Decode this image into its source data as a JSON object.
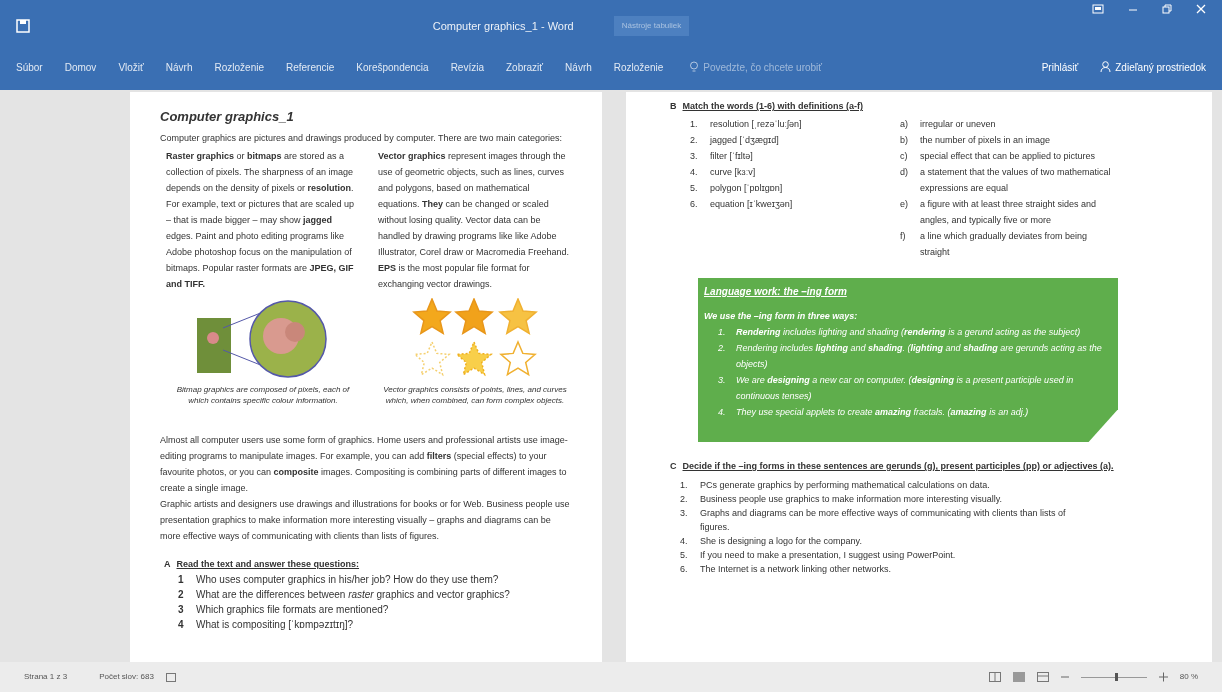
{
  "window": {
    "title": "Computer graphics_1 - Word",
    "context_label": "Nástroje tabuliek"
  },
  "ribbon": {
    "tabs": [
      {
        "label": "Súbor",
        "selected": false
      },
      {
        "label": "Domov",
        "selected": false
      },
      {
        "label": "Vložiť",
        "selected": false
      },
      {
        "label": "Návrh",
        "selected": false
      },
      {
        "label": "Rozloženie",
        "selected": false
      },
      {
        "label": "Referencie",
        "selected": false
      },
      {
        "label": "Korešpondencia",
        "selected": false
      },
      {
        "label": "Revízia",
        "selected": false
      },
      {
        "label": "Zobraziť",
        "selected": false
      },
      {
        "label": "Návrh",
        "selected": false
      },
      {
        "label": "Rozloženie",
        "selected": false
      }
    ],
    "tell_me": "Povedzte, čo chcete urobiť",
    "sign_in": "Prihlásiť",
    "share": "Zdieľaný prostriedok"
  },
  "left_page": {
    "title": "Computer graphics_1",
    "intro": "Computer graphics are pictures and drawings produced by computer. There are two main categories:",
    "columns": [
      "**Raster graphics** or **bitmaps** are stored as a collection of pixels. The sharpness of an image depends on the density of pixels or **resolution**. For example, text or pictures that are scaled up – that is made bigger – may show **jagged** edges. Paint and photo editing programs like Adobe photoshop focus on the manipulation of bitmaps. Popular raster formats are **JPEG, GIF and TIFF.**",
      "**Vector graphics** represent images through the use of geometric objects, such as lines, curves and polygons, based on mathematical equations. **They** can be changed or scaled without losing quality. Vector data can be handled by drawing programs like like Adobe Illustrator, Corel draw or Macromedia Freehand. **EPS** is the most popular file format for exchanging vector drawings."
    ],
    "captions": [
      "Bitmap graphics are composed of pixels, each of which contains specific colour information.",
      "Vector graphics consists of points, lines, and curves which, when combined, can form complex objects."
    ],
    "paragraphs": [
      "Almost all computer users use some form of graphics. Home users and professional artists use image-editing programs to manipulate images. For example, you can add **filters** (special effects) to your favourite photos, or you can **composite** images. Compositing is combining parts of different images to create a single image.",
      "Graphic artists and designers use drawings and illustrations for books or for Web. Business people use presentation graphics to make information more interesting visually – graphs and diagrams can be more effective ways of communicating with clients than lists of figures."
    ],
    "section_a": {
      "letter": "A",
      "heading": "Read the text and answer these questions:",
      "items": [
        {
          "number": "1",
          "text": "Who uses computer graphics in his/her job? How do they use them?"
        },
        {
          "number": "2",
          "text": "What are the differences between *raster* graphics and vector graphics?"
        },
        {
          "number": "3",
          "text": "Which graphics file formats are mentioned?"
        },
        {
          "number": "4",
          "text": "What is compositing [ˈkɒmpəzɪtɪŋ]?"
        }
      ]
    }
  },
  "right_page": {
    "section_b": {
      "letter": "B",
      "heading": "Match the words (1-6) with definitions (a-f)",
      "words": [
        {
          "number": "1.",
          "text": "resolution [ˌrezəˈluːʃən]"
        },
        {
          "number": "2.",
          "text": "jagged [ˈdʒæɡɪd]"
        },
        {
          "number": "3.",
          "text": "filter [ˈfɪltə]"
        },
        {
          "number": "4.",
          "text": "curve [kɜːv]"
        },
        {
          "number": "5.",
          "text": "polygon [ˈpɒlɪɡɒn]"
        },
        {
          "number": "6.",
          "text": "equation [ɪˈkweɪʒən]"
        }
      ],
      "definitions": [
        {
          "letter": "a)",
          "text": "irregular or uneven"
        },
        {
          "letter": "b)",
          "text": "the number of pixels in an image"
        },
        {
          "letter": "c)",
          "text": "special effect that can be applied to pictures"
        },
        {
          "letter": "d)",
          "text": "a statement that the values of two mathematical expressions are equal"
        },
        {
          "letter": "e)",
          "text": "a figure with at least three straight sides and angles, and typically five or more"
        },
        {
          "letter": "f)",
          "text": "a line which gradually deviates from being straight"
        }
      ]
    },
    "language_box": {
      "title": "Language work: the –ing form",
      "intro": "We use the –ing form in three ways:",
      "items": [
        {
          "number": "1.",
          "text": "**Rendering** includes lighting and shading (**rendering** is a gerund acting as the subject)"
        },
        {
          "number": "2.",
          "text": "Rendering includes **lighting** and **shading**. (**lighting** and **shading** are gerunds acting as the objects)"
        },
        {
          "number": "3.",
          "text": "We are **designing** a new car on computer. (**designing** is a present participle used in continuous tenses)"
        },
        {
          "number": "4.",
          "text": "They use special applets to create **amazing** fractals. (**amazing** is an adj.)"
        }
      ]
    },
    "section_c": {
      "letter": "C",
      "heading": "Decide if the –ing forms in these sentences are gerunds (g), present participles (pp) or adjectives (a).",
      "items": [
        {
          "number": "1.",
          "text": "PCs generate graphics by performing mathematical calculations on data."
        },
        {
          "number": "2.",
          "text": "Business people use graphics to make information more interesting visually."
        },
        {
          "number": "3.",
          "text": "Graphs and diagrams can be more effective ways of communicating with clients than lists of figures."
        },
        {
          "number": "4.",
          "text": "She is designing a logo for the company."
        },
        {
          "number": "5.",
          "text": "If you need to make a presentation, I suggest using PowerPoint."
        },
        {
          "number": "6.",
          "text": "The Internet is a network linking other networks."
        }
      ]
    }
  },
  "status_bar": {
    "page": "Strana 1 z 3",
    "words": "Počet slov: 683",
    "zoom": "80 %",
    "level": 0.55
  }
}
